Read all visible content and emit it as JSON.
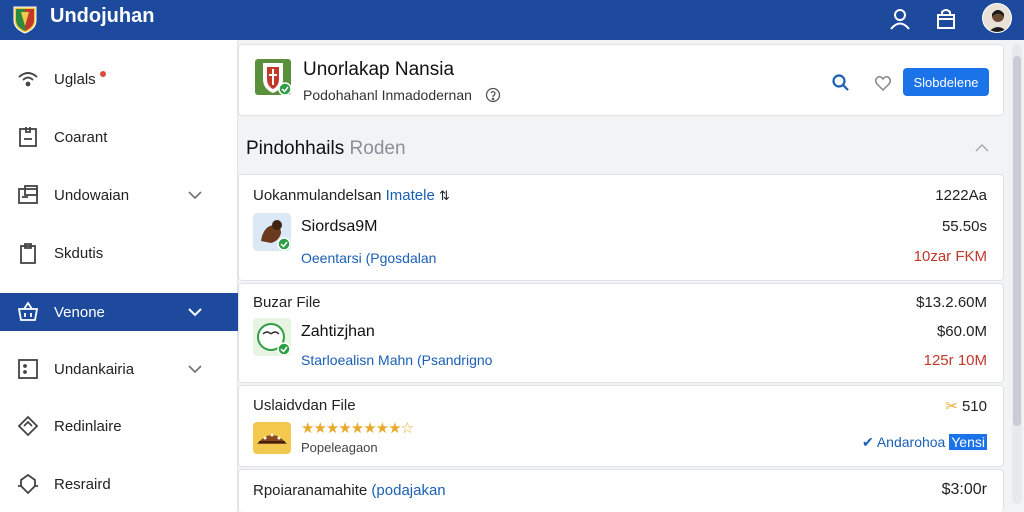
{
  "app": {
    "title": "Undojuhan"
  },
  "sidebar": {
    "items": [
      {
        "label": "Uglals",
        "icon": "wifi-icon"
      },
      {
        "label": "Coarant",
        "icon": "document-icon"
      },
      {
        "label": "Undowaian",
        "icon": "folder-icon"
      },
      {
        "label": "Skdutis",
        "icon": "clipboard-icon"
      },
      {
        "label": "Venone",
        "icon": "basket-icon"
      },
      {
        "label": "Undankairia",
        "icon": "grid-icon"
      },
      {
        "label": "Redinlaire",
        "icon": "tag-icon"
      },
      {
        "label": "Resraird",
        "icon": "shield-icon"
      }
    ]
  },
  "header": {
    "title": "Unorlakap Nansia",
    "subtitle": "Podohahanl Inmadodernan",
    "button_label": "Slobdelene"
  },
  "section": {
    "title": "Pindohhails",
    "title_muted": "Roden"
  },
  "rows": [
    {
      "top": "Uokanmulandelsan",
      "top_blue": "Imatele",
      "name": "Siordsa9M",
      "link": "Oeentarsi (Pgosdalan",
      "v1": "1222Aa",
      "v2": "55.50s",
      "v3": "10zar FKM"
    },
    {
      "top": "Buzar File",
      "name": "Zahtizjhan",
      "link": "Starloealisn Mahn (Psandrigno",
      "v1": "$13.2.60M",
      "v2": "$60.0M",
      "v3": "125r 10M"
    },
    {
      "top": "Uslaidvdan File",
      "name": "Popeleagaon",
      "rating": 4.5,
      "v1": "510",
      "status": "Andarohoa",
      "status_tag": "Yensi"
    },
    {
      "top": "Rpoiaranamahite",
      "top_blue": "(podajakan",
      "v1": "$3:00r"
    }
  ],
  "colors": {
    "topbar": "#1d4a9c",
    "accent": "#1a73e8",
    "active": "#1d4a9c",
    "success": "#2e9e44",
    "danger": "#c0392b"
  }
}
